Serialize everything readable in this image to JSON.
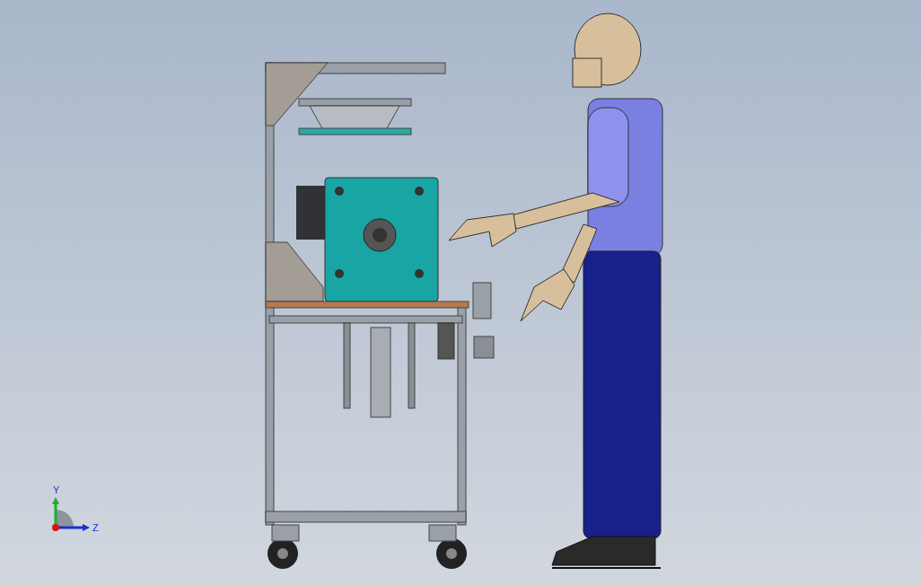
{
  "triad": {
    "axes": [
      {
        "label": "Y",
        "color": "#18b030",
        "kind": "vertical"
      },
      {
        "label": "Z",
        "color": "#1830d0",
        "kind": "horizontal"
      }
    ]
  }
}
